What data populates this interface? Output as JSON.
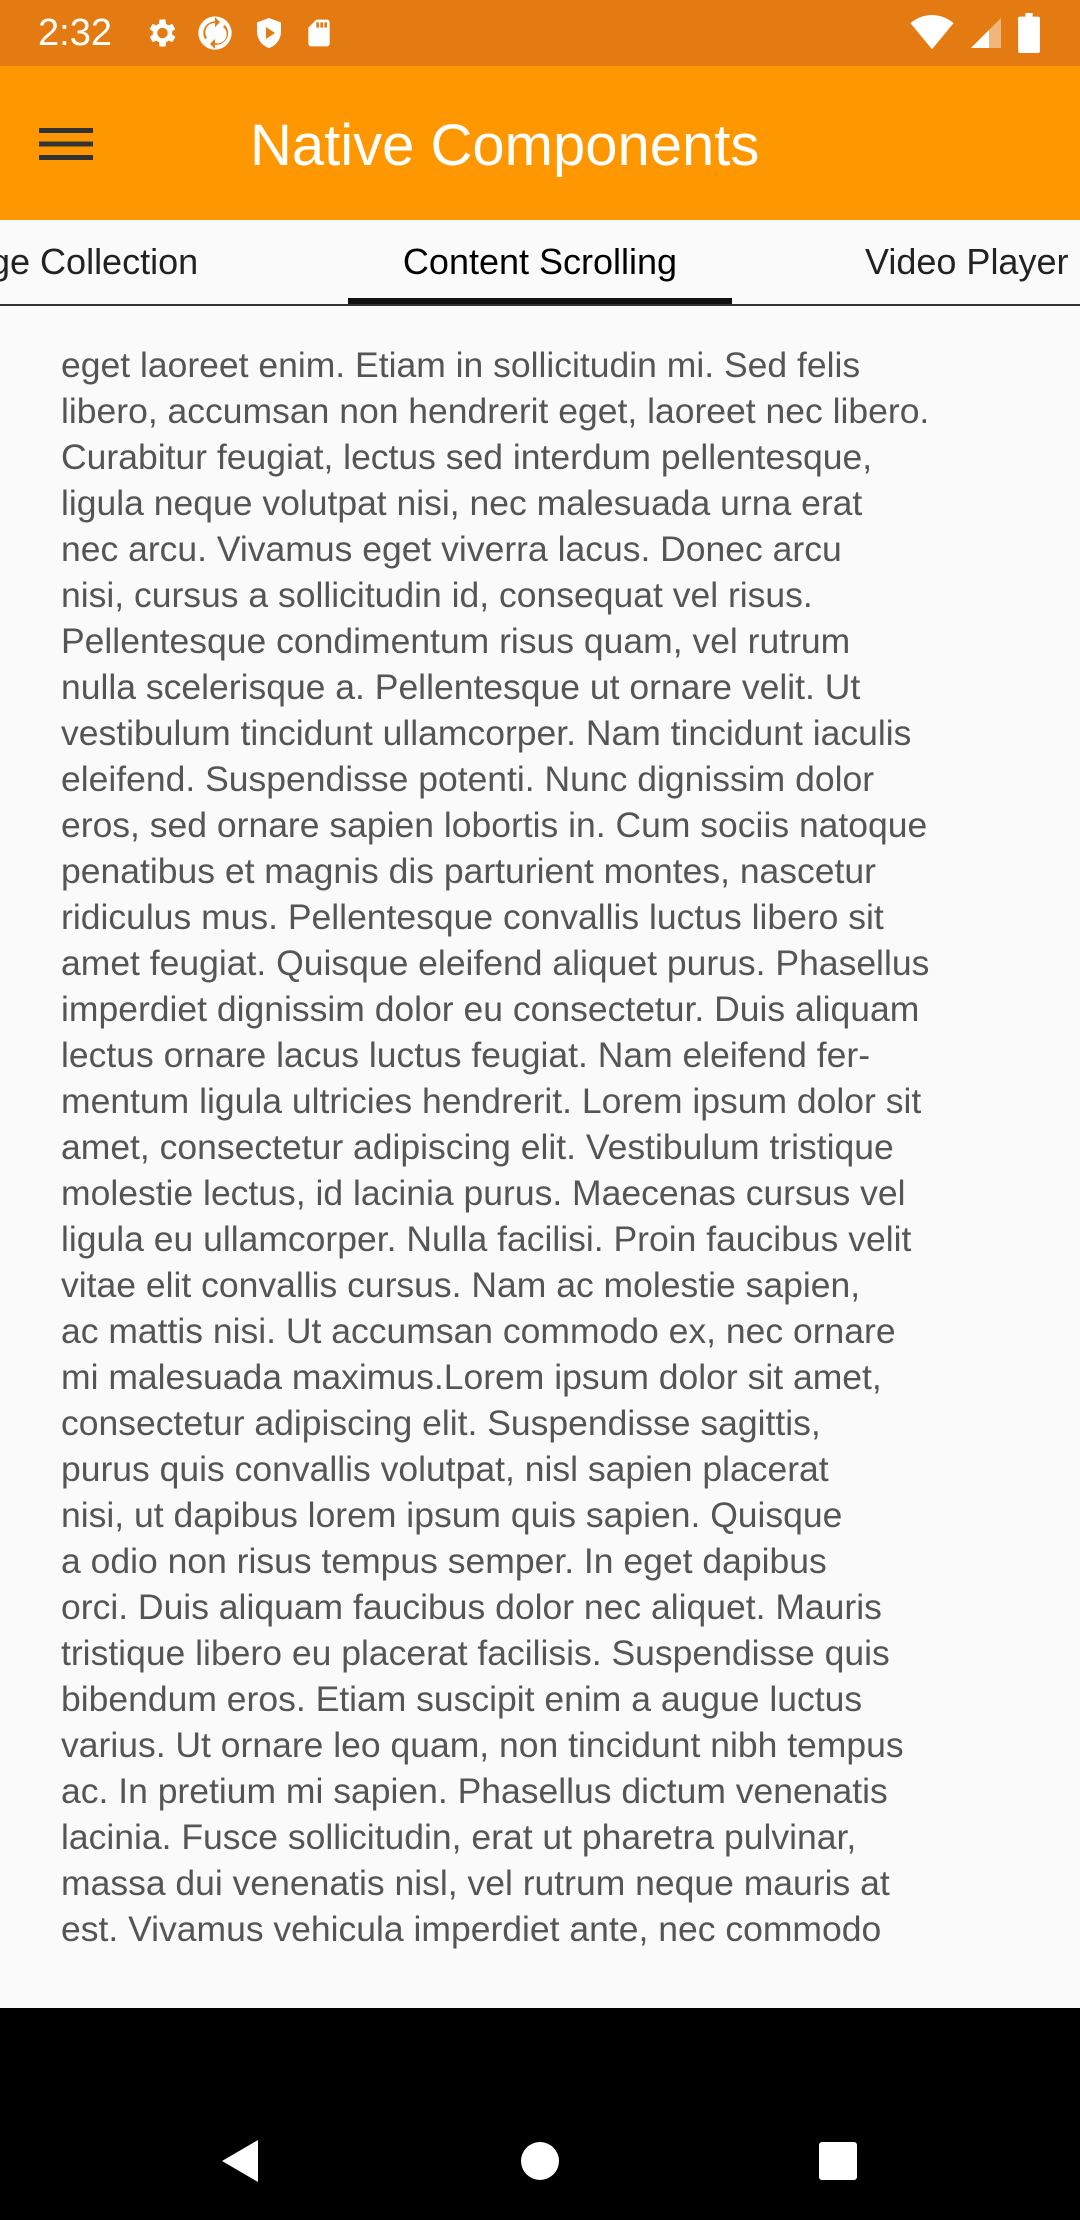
{
  "status_bar": {
    "time": "2:32",
    "left_icons": [
      "settings-icon",
      "sync-icon",
      "play-protect-icon",
      "sd-card-icon"
    ],
    "right_icons": [
      "wifi-icon",
      "cell-signal-icon",
      "battery-icon"
    ]
  },
  "app_bar": {
    "title": "Native Components",
    "menu_icon": "hamburger-menu-icon",
    "background": "#FF9800",
    "status_background": "#E47A12"
  },
  "tabs": [
    {
      "label": "ge Collection",
      "selected": false
    },
    {
      "label": "Content Scrolling",
      "selected": true
    },
    {
      "label": "Video Player",
      "selected": false
    }
  ],
  "content": {
    "lines": [
      "eget laoreet enim. Etiam in sollicitudin mi. Sed felis",
      "libero, accumsan non hendrerit eget, laoreet nec libero.",
      "Curabitur feugiat, lectus sed interdum pellentesque,",
      "ligula neque volutpat nisi, nec malesuada urna erat",
      "nec arcu. Vivamus eget viverra lacus. Donec arcu",
      "nisi, cursus a sollicitudin id, consequat vel risus.",
      "Pellentesque condimentum risus quam, vel rutrum",
      "nulla scelerisque a. Pellentesque ut ornare velit. Ut",
      "vestibulum tincidunt ullamcorper. Nam tincidunt iaculis",
      "eleifend. Suspendisse potenti. Nunc dignissim dolor",
      "eros, sed ornare sapien lobortis in. Cum sociis natoque",
      "penatibus et magnis dis parturient montes, nascetur",
      "ridiculus mus. Pellentesque convallis luctus libero sit",
      "amet feugiat. Quisque eleifend aliquet purus. Phasellus",
      "imperdiet dignissim dolor eu consectetur. Duis aliquam",
      "lectus ornare lacus luctus feugiat. Nam eleifend fer-",
      "mentum ligula ultricies hendrerit. Lorem ipsum dolor sit",
      "amet, consectetur adipiscing elit. Vestibulum tristique",
      "molestie lectus, id lacinia purus. Maecenas cursus vel",
      "ligula eu ullamcorper. Nulla facilisi. Proin faucibus velit",
      "vitae elit convallis cursus. Nam ac molestie sapien,",
      "ac mattis nisi. Ut accumsan commodo ex, nec ornare",
      "mi malesuada maximus.Lorem ipsum dolor sit amet,",
      "consectetur adipiscing elit. Suspendisse sagittis,",
      "purus quis convallis volutpat, nisl sapien placerat",
      "nisi, ut dapibus lorem ipsum quis sapien. Quisque",
      "a odio non risus tempus semper. In eget dapibus",
      "orci. Duis aliquam faucibus dolor nec aliquet. Mauris",
      "tristique libero eu placerat facilisis. Suspendisse quis",
      "bibendum eros. Etiam suscipit enim a augue luctus",
      "varius. Ut ornare leo quam, non tincidunt nibh tempus",
      "ac. In pretium mi sapien. Phasellus dictum venenatis",
      "lacinia. Fusce sollicitudin, erat ut pharetra pulvinar,",
      "massa dui venenatis nisl, vel rutrum neque mauris at",
      "est. Vivamus vehicula imperdiet ante, nec commodo"
    ]
  },
  "nav_bar": {
    "buttons": [
      "back-icon",
      "home-icon",
      "recents-icon"
    ]
  }
}
